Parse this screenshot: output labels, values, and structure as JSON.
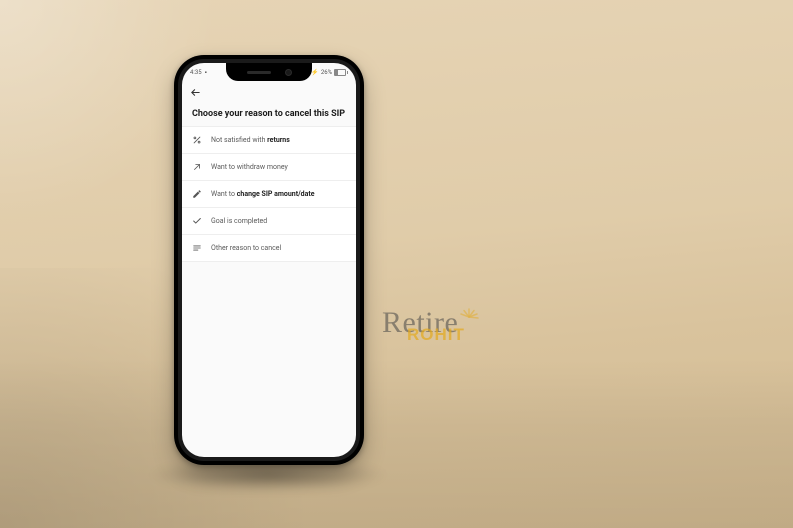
{
  "status": {
    "time": "4:35",
    "battery_text": "26%"
  },
  "page": {
    "title": "Choose your reason to cancel this SIP"
  },
  "reasons": [
    {
      "icon": "percent-icon",
      "pre": "Not satisfied with ",
      "bold": "returns",
      "post": ""
    },
    {
      "icon": "arrow-up-right-icon",
      "pre": "Want to withdraw money",
      "bold": "",
      "post": ""
    },
    {
      "icon": "pencil-icon",
      "pre": "Want to ",
      "bold": "change SIP amount/date",
      "post": ""
    },
    {
      "icon": "check-icon",
      "pre": "Goal is completed",
      "bold": "",
      "post": ""
    },
    {
      "icon": "list-icon",
      "pre": "Other reason to cancel",
      "bold": "",
      "post": ""
    }
  ],
  "brand": {
    "line1": "Retire",
    "line2": "ROHIT"
  }
}
